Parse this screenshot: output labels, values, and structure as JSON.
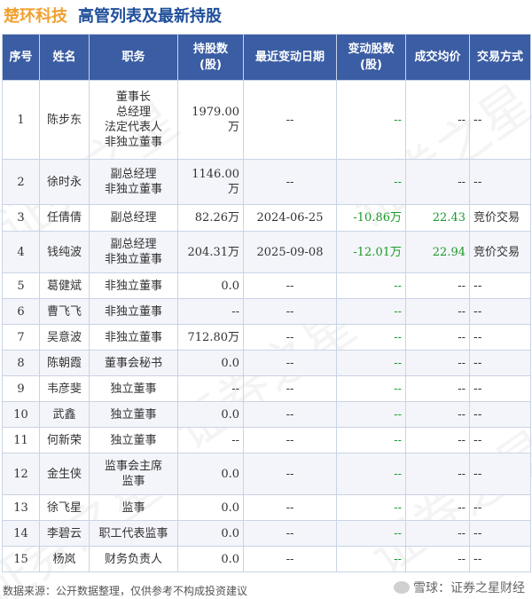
{
  "header": {
    "company": "楚环科技",
    "title": "高管列表及最新持股"
  },
  "table": {
    "columns": [
      "序号",
      "姓名",
      "职务",
      "持股数\n(股)",
      "最近变动日期",
      "变动股数\n(股)",
      "成交均价",
      "交易方式"
    ],
    "rows": [
      {
        "no": "1",
        "name": "陈步东",
        "positions": [
          "董事长",
          "总经理",
          "法定代表人",
          "非独立董事"
        ],
        "shares": "1979.00万",
        "date": "--",
        "change": "--",
        "price": "--",
        "method": "--"
      },
      {
        "no": "2",
        "name": "徐时永",
        "positions": [
          "副总经理",
          "非独立董事"
        ],
        "shares": "1146.00万",
        "date": "--",
        "change": "--",
        "price": "--",
        "method": "--"
      },
      {
        "no": "3",
        "name": "任倩倩",
        "positions": [
          "副总经理"
        ],
        "shares": "82.26万",
        "date": "2024-06-25",
        "change": "-10.86万",
        "price": "22.43",
        "method": "竞价交易"
      },
      {
        "no": "4",
        "name": "钱纯波",
        "positions": [
          "副总经理",
          "非独立董事"
        ],
        "shares": "204.31万",
        "date": "2025-09-08",
        "change": "-12.01万",
        "price": "22.94",
        "method": "竞价交易"
      },
      {
        "no": "5",
        "name": "葛健斌",
        "positions": [
          "非独立董事"
        ],
        "shares": "0.0",
        "date": "--",
        "change": "--",
        "price": "--",
        "method": "--"
      },
      {
        "no": "6",
        "name": "曹飞飞",
        "positions": [
          "非独立董事"
        ],
        "shares": "--",
        "date": "--",
        "change": "--",
        "price": "--",
        "method": "--"
      },
      {
        "no": "7",
        "name": "吴意波",
        "positions": [
          "非独立董事"
        ],
        "shares": "712.80万",
        "date": "--",
        "change": "--",
        "price": "--",
        "method": "--"
      },
      {
        "no": "8",
        "name": "陈朝霞",
        "positions": [
          "董事会秘书"
        ],
        "shares": "0.0",
        "date": "--",
        "change": "--",
        "price": "--",
        "method": "--"
      },
      {
        "no": "9",
        "name": "韦彦斐",
        "positions": [
          "独立董事"
        ],
        "shares": "--",
        "date": "--",
        "change": "--",
        "price": "--",
        "method": "--"
      },
      {
        "no": "10",
        "name": "武鑫",
        "positions": [
          "独立董事"
        ],
        "shares": "0.0",
        "date": "--",
        "change": "--",
        "price": "--",
        "method": "--"
      },
      {
        "no": "11",
        "name": "何新荣",
        "positions": [
          "独立董事"
        ],
        "shares": "--",
        "date": "--",
        "change": "--",
        "price": "--",
        "method": "--"
      },
      {
        "no": "12",
        "name": "金生侠",
        "positions": [
          "监事会主席",
          "监事"
        ],
        "shares": "0.0",
        "date": "--",
        "change": "--",
        "price": "--",
        "method": "--"
      },
      {
        "no": "13",
        "name": "徐飞星",
        "positions": [
          "监事"
        ],
        "shares": "0.0",
        "date": "--",
        "change": "--",
        "price": "--",
        "method": "--"
      },
      {
        "no": "14",
        "name": "李碧云",
        "positions": [
          "职工代表监事"
        ],
        "shares": "0.0",
        "date": "--",
        "change": "--",
        "price": "--",
        "method": "--"
      },
      {
        "no": "15",
        "name": "杨岚",
        "positions": [
          "财务负责人"
        ],
        "shares": "0.0",
        "date": "--",
        "change": "--",
        "price": "--",
        "method": "--"
      }
    ]
  },
  "footer": {
    "source": "数据来源：公开数据整理，仅供参考不构成投资建议",
    "brand": "雪球：证券之星财经"
  },
  "watermark": "证券之星",
  "colors": {
    "header_bg": "#3b5da3",
    "company": "#f0a030",
    "title": "#1f4e9a",
    "negative": "#1a9a27",
    "positive": "#1a9a27"
  }
}
